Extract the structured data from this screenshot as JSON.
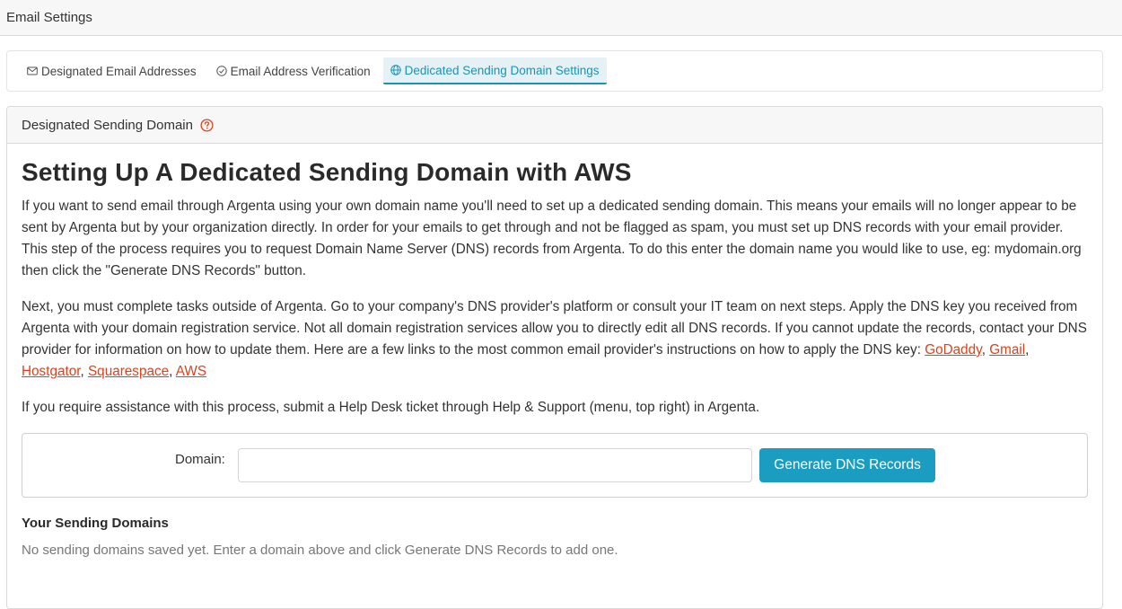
{
  "header": {
    "title": "Email Settings"
  },
  "tabs": [
    {
      "label": "Designated Email Addresses",
      "icon": "envelope-icon"
    },
    {
      "label": "Email Address Verification",
      "icon": "check-circle-icon"
    },
    {
      "label": "Dedicated Sending Domain Settings",
      "icon": "globe-icon",
      "active": true
    }
  ],
  "panel": {
    "header_title": "Designated Sending Domain",
    "help_icon": "help-circle-icon",
    "heading": "Setting Up A Dedicated Sending Domain with AWS",
    "paragraph1": "If you want to send email through Argenta using your own domain name you'll need to set up a dedicated sending domain. This means your emails will no longer appear to be sent by Argenta but by your organization directly. In order for your emails to get through and not be flagged as spam, you must set up DNS records with your email provider. This step of the process requires you to request Domain Name Server (DNS) records from Argenta. To do this enter the domain name you would like to use, eg: mydomain.org then click the \"Generate DNS Records\" button.",
    "paragraph2_text": "Next, you must complete tasks outside of Argenta. Go to your company's DNS provider's platform or consult your IT team on next steps. Apply the DNS key you received from Argenta with your domain registration service. Not all domain registration services allow you to directly edit all DNS records. If you cannot update the records, contact your DNS provider for information on how to update them. Here are a few links to the most common email provider's instructions on how to apply the DNS key: ",
    "links": [
      "GoDaddy",
      "Gmail",
      "Hostgator",
      "Squarespace",
      "AWS"
    ],
    "link_separator": ", ",
    "paragraph3": "If you require assistance with this process, submit a Help Desk ticket through Help & Support (menu, top right) in Argenta.",
    "domain_label": "Domain:",
    "domain_value": "",
    "generate_button": "Generate DNS Records",
    "sending_domains_title": "Your Sending Domains",
    "empty_message": "No sending domains saved yet. Enter a domain above and click Generate DNS Records to add one."
  },
  "colors": {
    "accent": "#1a9dc0",
    "link": "#e0401a",
    "active_tab_bg": "#e5f1f5"
  }
}
